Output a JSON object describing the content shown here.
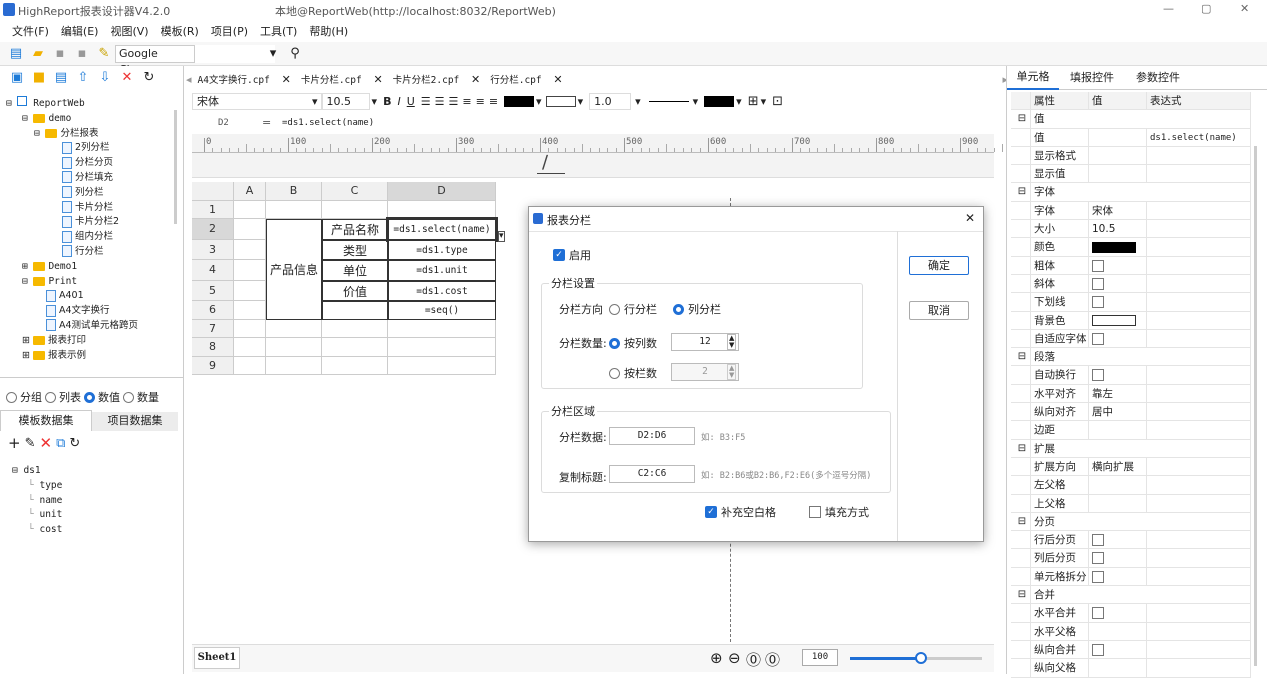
{
  "title": {
    "app": "HighReport报表设计器V4.2.0",
    "conn": "本地@ReportWeb(http://localhost:8032/ReportWeb)",
    "min": "—",
    "max": "▢",
    "close": "✕"
  },
  "menu": [
    "文件(F)",
    "编辑(E)",
    "视图(V)",
    "模板(R)",
    "项目(P)",
    "工具(T)",
    "帮助(H)"
  ],
  "toolbar": {
    "browser": "Google Chrome"
  },
  "tree": {
    "root": "ReportWeb",
    "demo": "demo",
    "grp": "分栏报表",
    "items": [
      "2列分栏",
      "分栏分页",
      "分栏填充",
      "列分栏",
      "卡片分栏",
      "卡片分栏2",
      "组内分栏",
      "行分栏"
    ],
    "demo1": "Demo1",
    "print": "Print",
    "pitems": [
      "A401",
      "A4文字换行",
      "A4测试单元格跨页"
    ],
    "f1": "报表打印",
    "f2": "报表示例"
  },
  "radios": [
    "分组",
    "列表",
    "数值",
    "数量"
  ],
  "dstabs": [
    "模板数据集",
    "项目数据集"
  ],
  "ds": {
    "name": "ds1",
    "fields": [
      "type",
      "name",
      "unit",
      "cost"
    ]
  },
  "tabs": [
    "A4文字换行.cpf",
    "卡片分栏.cpf",
    "卡片分栏2.cpf",
    "行分栏.cpf"
  ],
  "fmt": {
    "font": "宋体",
    "size": "10.5",
    "line": "1.0"
  },
  "formula": {
    "cell": "D2",
    "eq": "=",
    "text": "=ds1.select(name)"
  },
  "ruler": [
    "0",
    "100",
    "200",
    "300",
    "400",
    "500",
    "600",
    "700",
    "800",
    "900"
  ],
  "grid": {
    "cols": [
      "A",
      "B",
      "C",
      "D"
    ],
    "rows": [
      "1",
      "2",
      "3",
      "4",
      "5",
      "6",
      "7",
      "8",
      "9"
    ],
    "b": "产品信息",
    "c": [
      "产品名称",
      "类型",
      "单位",
      "价值"
    ],
    "d": [
      "=ds1.select(name)",
      "=ds1.type",
      "=ds1.unit",
      "=ds1.cost",
      "=seq()"
    ]
  },
  "sheet": "Sheet1",
  "zoom": "100",
  "dialog": {
    "title": "报表分栏",
    "enable": "启用",
    "g1": "分栏设置",
    "dir": "分栏方向",
    "row": "行分栏",
    "col": "列分栏",
    "cnt": "分栏数量:",
    "bycol": "按列数",
    "colv": "12",
    "bygrp": "按栏数",
    "grpv": "2",
    "g2": "分栏区域",
    "data": "分栏数据:",
    "datav": "D2:D6",
    "datah": "如: B3:F5",
    "copy": "复制标题:",
    "copyv": "C2:C6",
    "copyh": "如: B2:B6或B2:B6,F2:E6(多个逗号分隔)",
    "fill": "补充空白格",
    "fillm": "填充方式",
    "ok": "确定",
    "cancel": "取消"
  },
  "rtabs": [
    "单元格",
    "填报控件",
    "参数控件"
  ],
  "rhdr": [
    "属性",
    "值",
    "表达式"
  ],
  "props": [
    {
      "g": 1,
      "n": "值"
    },
    {
      "n": "值",
      "e": "ds1.select(name)"
    },
    {
      "n": "显示格式"
    },
    {
      "n": "显示值"
    },
    {
      "g": 1,
      "n": "字体"
    },
    {
      "n": "字体",
      "v": "宋体"
    },
    {
      "n": "大小",
      "v": "10.5"
    },
    {
      "n": "颜色",
      "k": "black"
    },
    {
      "n": "粗体",
      "k": "cb"
    },
    {
      "n": "斜体",
      "k": "cb"
    },
    {
      "n": "下划线",
      "k": "cb"
    },
    {
      "n": "背景色",
      "k": "white"
    },
    {
      "n": "自适应字体",
      "k": "cb"
    },
    {
      "g": 1,
      "n": "段落"
    },
    {
      "n": "自动换行",
      "k": "cb"
    },
    {
      "n": "水平对齐",
      "v": "靠左"
    },
    {
      "n": "纵向对齐",
      "v": "居中"
    },
    {
      "n": "边距"
    },
    {
      "g": 1,
      "n": "扩展"
    },
    {
      "n": "扩展方向",
      "v": "横向扩展"
    },
    {
      "n": "左父格"
    },
    {
      "n": "上父格"
    },
    {
      "g": 1,
      "n": "分页"
    },
    {
      "n": "行后分页",
      "k": "cb"
    },
    {
      "n": "列后分页",
      "k": "cb"
    },
    {
      "n": "单元格拆分",
      "k": "cb"
    },
    {
      "g": 1,
      "n": "合并"
    },
    {
      "n": "水平合并",
      "k": "cb"
    },
    {
      "n": "水平父格"
    },
    {
      "n": "纵向合并",
      "k": "cb"
    },
    {
      "n": "纵向父格"
    }
  ]
}
